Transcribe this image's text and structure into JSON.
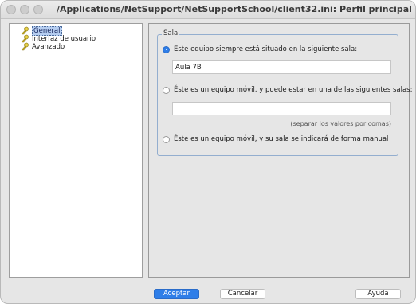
{
  "window": {
    "title": "/Applications/NetSupport/NetSupportSchool/client32.ini: Perfil principal"
  },
  "tree": {
    "items": [
      {
        "label": "General",
        "icon": "gear-key-icon",
        "selected": true
      },
      {
        "label": "Interfaz de usuario",
        "icon": "gear-key-icon"
      },
      {
        "label": "Avanzado",
        "icon": "gear-key-icon"
      }
    ]
  },
  "sala": {
    "group_title": "Sala",
    "option_fixed": "Este equipo siempre está situado en la siguiente sala:",
    "fixed_value": "Aula 7B",
    "option_mobile_list": "Éste es un equipo móvil, y puede estar en una de las siguientes salas:",
    "mobile_list_value": "",
    "mobile_list_hint": "(separar los valores por comas)",
    "option_manual": "Éste es un equipo móvil, y su sala se indicará de forma manual",
    "selected_option": "fixed"
  },
  "buttons": {
    "ok": "Aceptar",
    "cancel": "Cancelar",
    "help": "Ayuda"
  },
  "colors": {
    "accent": "#2f7ee8",
    "group_border": "#93aecf",
    "selection": "#b5cdf0"
  }
}
